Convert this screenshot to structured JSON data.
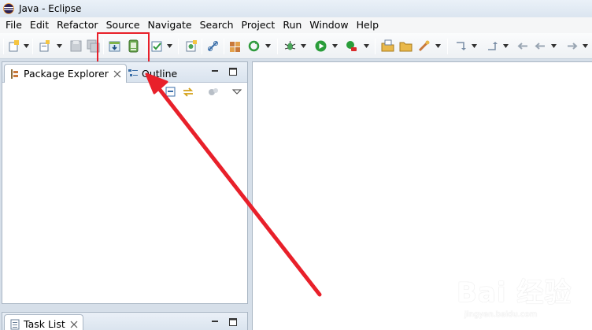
{
  "window": {
    "title": "Java - Eclipse"
  },
  "menu": [
    "File",
    "Edit",
    "Refactor",
    "Source",
    "Navigate",
    "Search",
    "Project",
    "Run",
    "Window",
    "Help"
  ],
  "views": {
    "left_top": {
      "tabs": [
        {
          "label": "Package Explorer",
          "active": true
        },
        {
          "label": "Outline",
          "active": false
        }
      ]
    },
    "left_bottom": {
      "tabs": [
        {
          "label": "Task List",
          "active": true
        }
      ]
    }
  },
  "watermark": {
    "brand": "Bai 经验",
    "url": "jingyan.baidu.com"
  },
  "colors": {
    "highlight": "#e8202a",
    "arrow": "#e8202a",
    "titlebar": "#dbe5f0"
  }
}
